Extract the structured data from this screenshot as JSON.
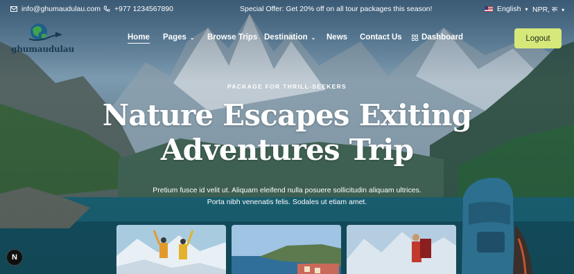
{
  "topbar": {
    "email": "info@ghumaudulau.com",
    "phone": "+977 1234567890",
    "offer": "Special Offer: Get 20% off on all tour packages this season!",
    "language": "English",
    "currency": "NPR, रू"
  },
  "brand": {
    "name": "ghumaudulau"
  },
  "nav": {
    "items": [
      "Home",
      "Pages",
      "Browse Trips",
      "Destination",
      "News",
      "Contact Us",
      "Dashboard"
    ],
    "active": "Home",
    "logout": "Logout"
  },
  "hero": {
    "eyebrow": "PACKAGE FOR THRILL-SEEKERS",
    "title_line1": "Nature Escapes Exiting",
    "title_line2": "Adventures Trip",
    "subtitle": "Pretium fusce id velit ut. Aliquam eleifend nulla posuere sollicitudin aliquam ultrices. Porta nibh venenatis felis. Sodales ut etiam amet."
  },
  "badge": {
    "label": "N"
  },
  "colors": {
    "accent": "#d6e87a",
    "navy": "#1a3a4f"
  }
}
